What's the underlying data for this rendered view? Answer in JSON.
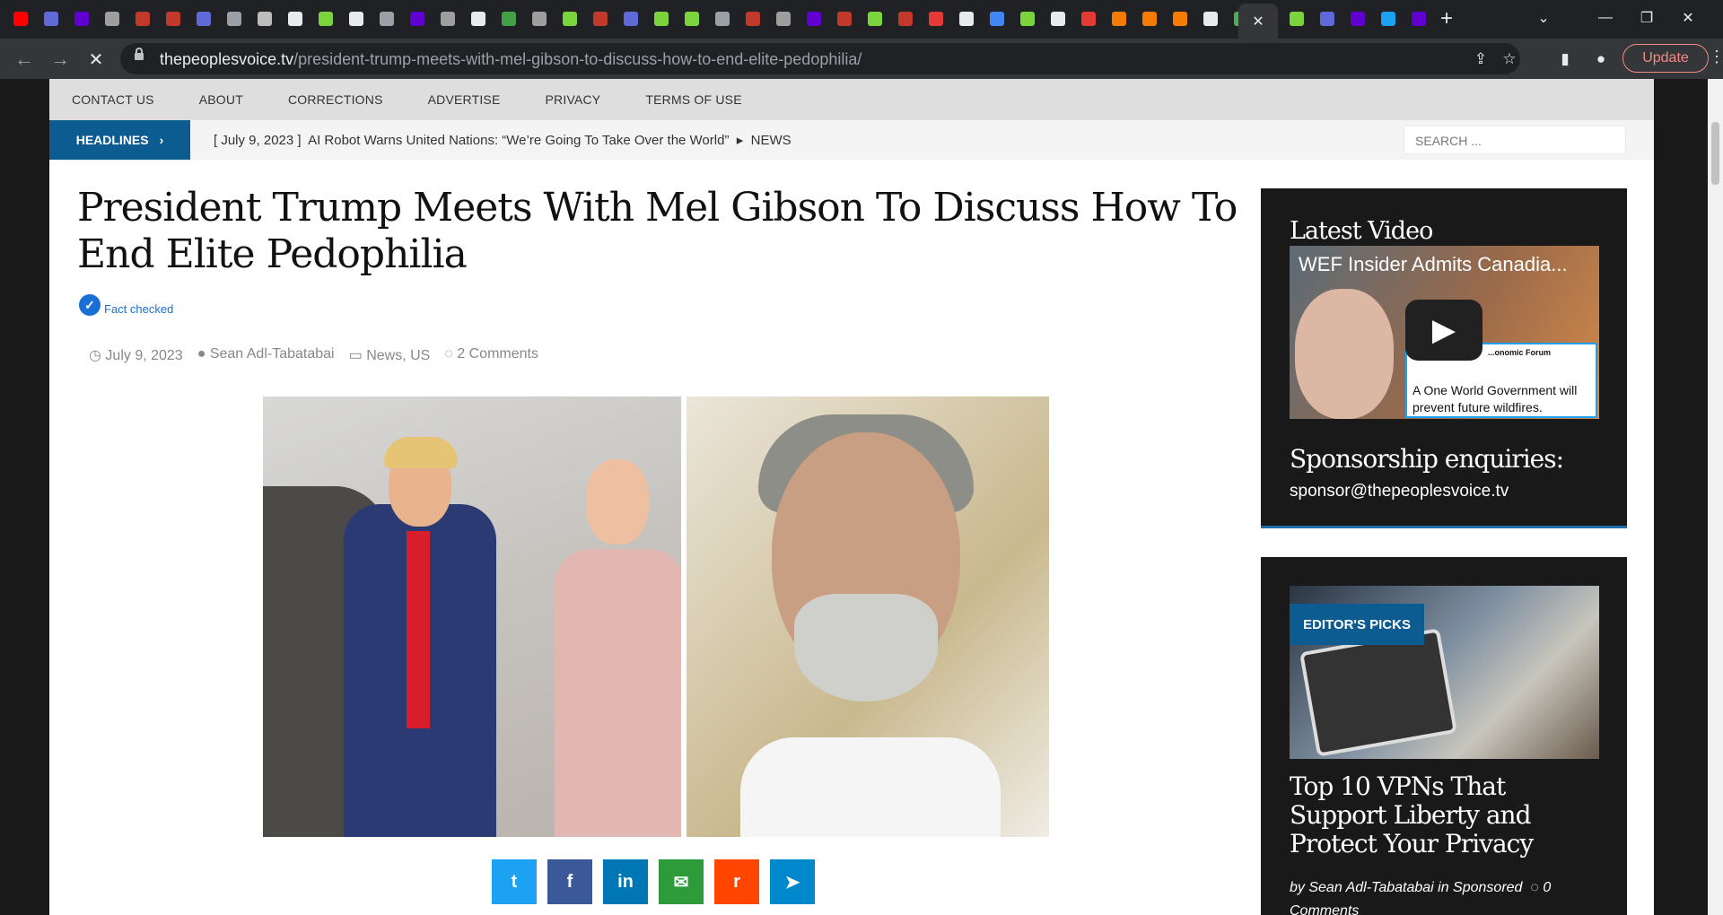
{
  "browser": {
    "active_tab_close": "✕",
    "new_tab": "+",
    "tab_icons": [
      {
        "name": "youtube-icon",
        "color": "#ff0000"
      },
      {
        "name": "shield-icon",
        "color": "#5f6ad8"
      },
      {
        "name": "yahoo-icon",
        "color": "#6001d2"
      },
      {
        "name": "news-icon",
        "color": "#9e9e9e"
      },
      {
        "name": "bi-icon",
        "color": "#c0392b"
      },
      {
        "name": "bi-icon",
        "color": "#c0392b"
      },
      {
        "name": "shield-icon",
        "color": "#5f6ad8"
      },
      {
        "name": "bookmark-icon",
        "color": "#9aa0a6"
      },
      {
        "name": "puzzle-icon",
        "color": "#bdbdbd"
      },
      {
        "name": "globe-icon",
        "color": "#e8eaed"
      },
      {
        "name": "play-icon",
        "color": "#7cd43c"
      },
      {
        "name": "globe-icon",
        "color": "#e8eaed"
      },
      {
        "name": "bookmark-icon",
        "color": "#9aa0a6"
      },
      {
        "name": "yahoo-icon",
        "color": "#6001d2"
      },
      {
        "name": "news-icon",
        "color": "#9e9e9e"
      },
      {
        "name": "globe-icon",
        "color": "#e8eaed"
      },
      {
        "name": "globe-icon",
        "color": "#43a047"
      },
      {
        "name": "news-icon",
        "color": "#9e9e9e"
      },
      {
        "name": "play-icon",
        "color": "#7cd43c"
      },
      {
        "name": "bi-icon",
        "color": "#c0392b"
      },
      {
        "name": "shield-icon",
        "color": "#5f6ad8"
      },
      {
        "name": "play-icon",
        "color": "#7cd43c"
      },
      {
        "name": "play-icon",
        "color": "#7cd43c"
      },
      {
        "name": "bookmark-icon",
        "color": "#9aa0a6"
      },
      {
        "name": "bi-icon",
        "color": "#c0392b"
      },
      {
        "name": "news-icon",
        "color": "#9e9e9e"
      },
      {
        "name": "yahoo-icon",
        "color": "#6001d2"
      },
      {
        "name": "bi-icon",
        "color": "#c0392b"
      },
      {
        "name": "play-icon",
        "color": "#7cd43c"
      },
      {
        "name": "bi-icon",
        "color": "#c0392b"
      },
      {
        "name": "alert-icon",
        "color": "#e53935"
      },
      {
        "name": "globe-icon",
        "color": "#e8eaed"
      },
      {
        "name": "search-icon",
        "color": "#4285f4"
      },
      {
        "name": "play-icon",
        "color": "#7cd43c"
      },
      {
        "name": "news-icon",
        "color": "#e8eaed"
      },
      {
        "name": "alert-icon",
        "color": "#e53935"
      },
      {
        "name": "bookmark-icon",
        "color": "#f57c00"
      },
      {
        "name": "bookmark-icon",
        "color": "#f57c00"
      },
      {
        "name": "bookmark-icon",
        "color": "#f57c00"
      },
      {
        "name": "document-icon",
        "color": "#e8eaed"
      },
      {
        "name": "g-icon",
        "color": "#4caf50"
      }
    ],
    "right_tab_icons": [
      {
        "name": "play-icon",
        "color": "#7cd43c"
      },
      {
        "name": "shield-icon",
        "color": "#5f6ad8"
      },
      {
        "name": "mail-icon",
        "color": "#6001d2"
      },
      {
        "name": "twitter-icon",
        "color": "#1da1f2"
      },
      {
        "name": "yahoo-icon",
        "color": "#6001d2"
      }
    ],
    "url_host": "thepeoplesvoice.tv",
    "url_path": "/president-trump-meets-with-mel-gibson-to-discuss-how-to-end-elite-pedophilia/",
    "update_label": "Update"
  },
  "site": {
    "topnav": [
      "CONTACT US",
      "ABOUT",
      "CORRECTIONS",
      "ADVERTISE",
      "PRIVACY",
      "TERMS OF USE"
    ],
    "headlines_label": "HEADLINES",
    "ticker_date": "[ July 9, 2023 ]",
    "ticker_headline": "AI Robot Warns United Nations: “We’re Going To Take Over the World”",
    "ticker_category": "NEWS",
    "search_placeholder": "SEARCH ...",
    "article": {
      "title": "President Trump Meets With Mel Gibson To Discuss How To End Elite Pedophilia",
      "fact_checked": "Fact checked",
      "date": "July 9, 2023",
      "author": "Sean Adl-Tabatabai",
      "categories": "News, US",
      "comments": "2 Comments"
    },
    "share": [
      {
        "name": "twitter-share-button",
        "label": "t",
        "color": "#1da1f2"
      },
      {
        "name": "facebook-share-button",
        "label": "f",
        "color": "#3b5998"
      },
      {
        "name": "linkedin-share-button",
        "label": "in",
        "color": "#0077b5"
      },
      {
        "name": "email-share-button",
        "label": "✉",
        "color": "#2e9b3a"
      },
      {
        "name": "reddit-share-button",
        "label": "r",
        "color": "#ff4500"
      },
      {
        "name": "telegram-share-button",
        "label": "➤",
        "color": "#0088cc"
      }
    ],
    "sidebar": {
      "latest_video": "Latest Video",
      "video_title": "WEF Insider Admits Canadia...",
      "video_tweet_org": "...onomic Forum",
      "video_tweet_text": "A One World Government will prevent future wildfires.",
      "sponsorship_heading": "Sponsorship enquiries:",
      "sponsorship_email": "sponsor@thepeoplesvoice.tv",
      "editors_picks": "EDITOR'S PICKS",
      "pick_title": "Top 10 VPNs That Support Liberty and Protect Your Privacy",
      "pick_meta": "by Sean Adl-Tabatabai in Sponsored",
      "pick_comments": "0 Comments"
    }
  }
}
